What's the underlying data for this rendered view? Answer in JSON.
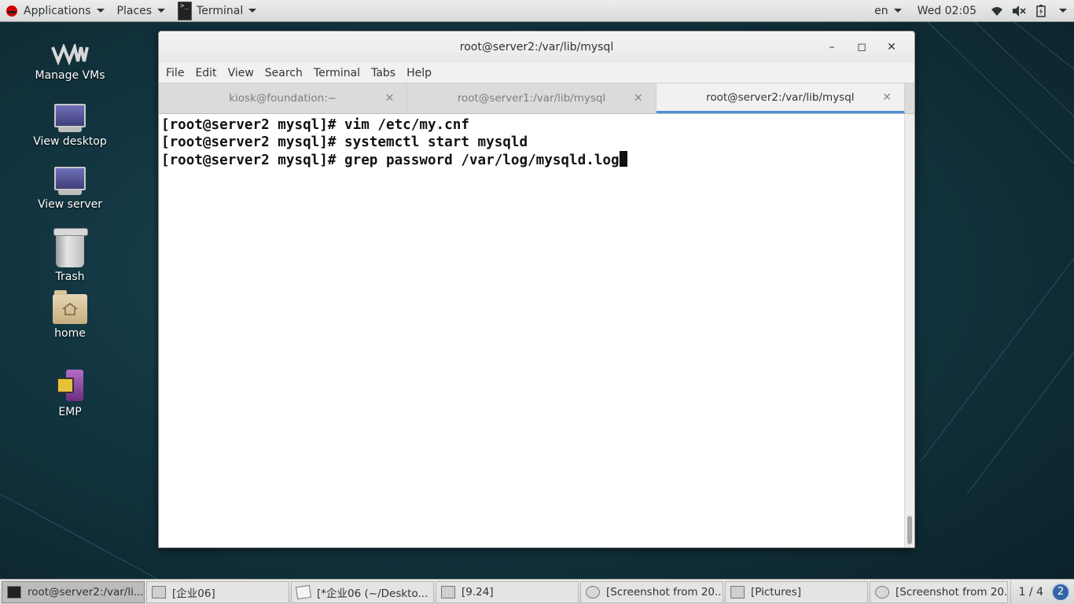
{
  "top_panel": {
    "applications": "Applications",
    "places": "Places",
    "terminal_app": "Terminal",
    "language": "en",
    "clock": "Wed 02:05"
  },
  "desktop_icons": [
    {
      "label": "Manage VMs",
      "icon": "vm-logo-icon"
    },
    {
      "label": "View desktop",
      "icon": "monitor-icon"
    },
    {
      "label": "View server",
      "icon": "monitor-icon"
    },
    {
      "label": "Trash",
      "icon": "trash-icon"
    },
    {
      "label": "home",
      "icon": "home-folder-icon"
    },
    {
      "label": "EMP",
      "icon": "emp-app-icon"
    }
  ],
  "window": {
    "title": "root@server2:/var/lib/mysql",
    "menu": [
      "File",
      "Edit",
      "View",
      "Search",
      "Terminal",
      "Tabs",
      "Help"
    ],
    "tabs": [
      {
        "label": "kiosk@foundation:~",
        "active": false
      },
      {
        "label": "root@server1:/var/lib/mysql",
        "active": false
      },
      {
        "label": "root@server2:/var/lib/mysql",
        "active": true
      }
    ],
    "terminal_lines": [
      "[root@server2 mysql]# vim /etc/my.cnf",
      "[root@server2 mysql]# systemctl start mysqld",
      "[root@server2 mysql]# grep password /var/log/mysqld.log"
    ]
  },
  "taskbar": {
    "tasks": [
      {
        "label": "root@server2:/var/li...",
        "active": true
      },
      {
        "label": "[企业06]",
        "active": false
      },
      {
        "label": "[*企业06 (~/Deskto...",
        "active": false
      },
      {
        "label": "[9.24]",
        "active": false
      },
      {
        "label": "[Screenshot from 20...",
        "active": false
      },
      {
        "label": "[Pictures]",
        "active": false
      },
      {
        "label": "[Screenshot from 20...",
        "active": false
      }
    ],
    "workspace": "1 / 4",
    "notifications": "2"
  },
  "colors": {
    "tab_active_underline": "#4a90d9",
    "notification_badge": "#3465a4"
  }
}
